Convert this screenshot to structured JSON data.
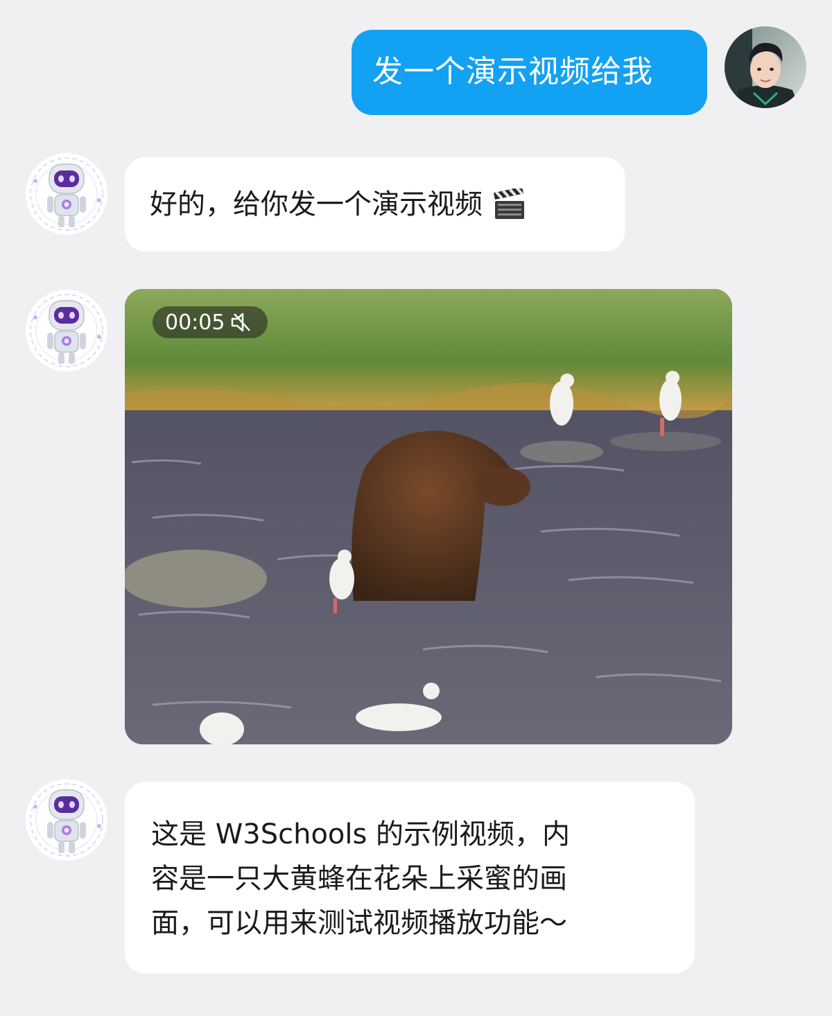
{
  "messages": {
    "user_1": {
      "text": "发一个演示视频给我"
    },
    "bot_1": {
      "text": "好的，给你发一个演示视频",
      "icon": "clapperboard-icon"
    },
    "bot_video": {
      "duration": "00:05",
      "muted": true,
      "icon": "speaker-muted-icon"
    },
    "bot_3": {
      "lines": [
        "这是 W3Schools 的示例视频，内",
        "容是一只大黄蜂在花朵上采蜜的画",
        "面，可以用来测试视频播放功能～"
      ]
    }
  },
  "colors": {
    "background": "#f0f0f3",
    "user_bubble": "#13a1f3",
    "bot_bubble": "#ffffff",
    "text": "#1a1a1a"
  }
}
